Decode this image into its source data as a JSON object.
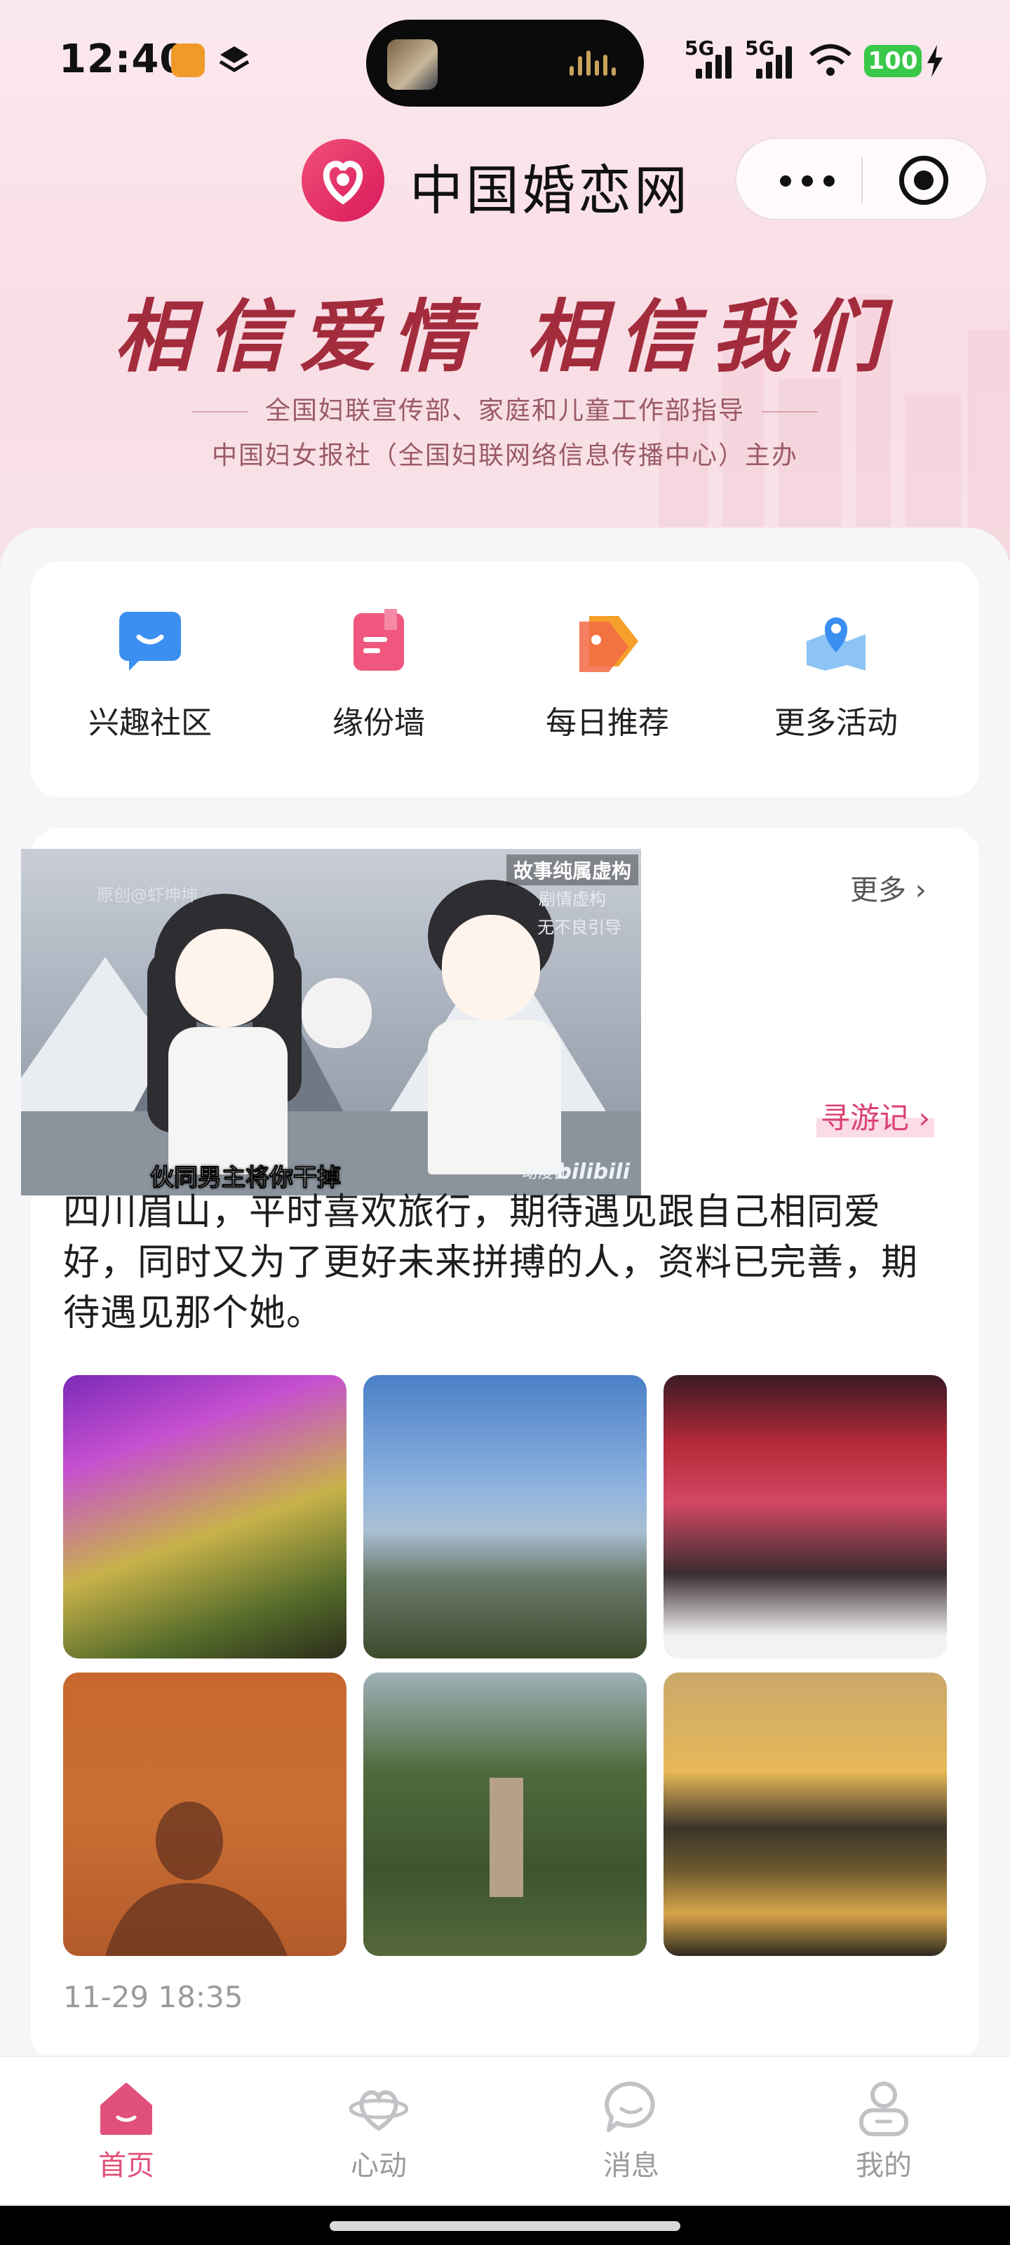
{
  "status_bar": {
    "time": "12:40",
    "signal_1": "5G",
    "signal_2": "5G",
    "battery": "100"
  },
  "header": {
    "title": "中国婚恋网",
    "slogan": "相信爱情 相信我们",
    "sub_line_1": "全国妇联宣传部、家庭和儿童工作部指导",
    "sub_line_2": "中国妇女报社（全国妇联网络信息传播中心）主办"
  },
  "quick_links": [
    {
      "label": "兴趣社区",
      "icon": "chat-bubble-icon",
      "color": "#3b8ff0"
    },
    {
      "label": "缘份墙",
      "icon": "bookmark-note-icon",
      "color": "#f0577e"
    },
    {
      "label": "每日推荐",
      "icon": "price-tag-icon",
      "color": "#f5a02a"
    },
    {
      "label": "更多活动",
      "icon": "map-pin-icon",
      "color": "#4aa6f0"
    }
  ],
  "post": {
    "more_label": "更多",
    "tag": "寻游记",
    "text": "四川眉山，平时喜欢旅行，期待遇见跟自己相同爱好，同时又为了更好未来拼搏的人，资料已完善，期待遇见那个她。",
    "timestamp": "11-29 18:35",
    "photos": [
      "cave-photo",
      "sea-cliff-photo",
      "opera-stage-photo",
      "shadow-wall-photo",
      "forest-stone-photo",
      "sunset-lake-photo"
    ]
  },
  "video_overlay": {
    "caption": "伙同男主将你干掉",
    "top_right": "故事纯属虚构",
    "note_1": "剧情虚构",
    "note_2": "无不良引导",
    "watermark": "原创@虾坤坤",
    "source": "动漫社",
    "platform": "bilibili"
  },
  "tabbar": [
    {
      "label": "首页",
      "icon": "home-icon",
      "active": true
    },
    {
      "label": "心动",
      "icon": "heart-planet-icon",
      "active": false
    },
    {
      "label": "消息",
      "icon": "message-bubble-icon",
      "active": false
    },
    {
      "label": "我的",
      "icon": "person-icon",
      "active": false
    }
  ],
  "colors": {
    "accent": "#e0507a",
    "slogan": "#a32c3c",
    "tag": "#d9416f"
  }
}
